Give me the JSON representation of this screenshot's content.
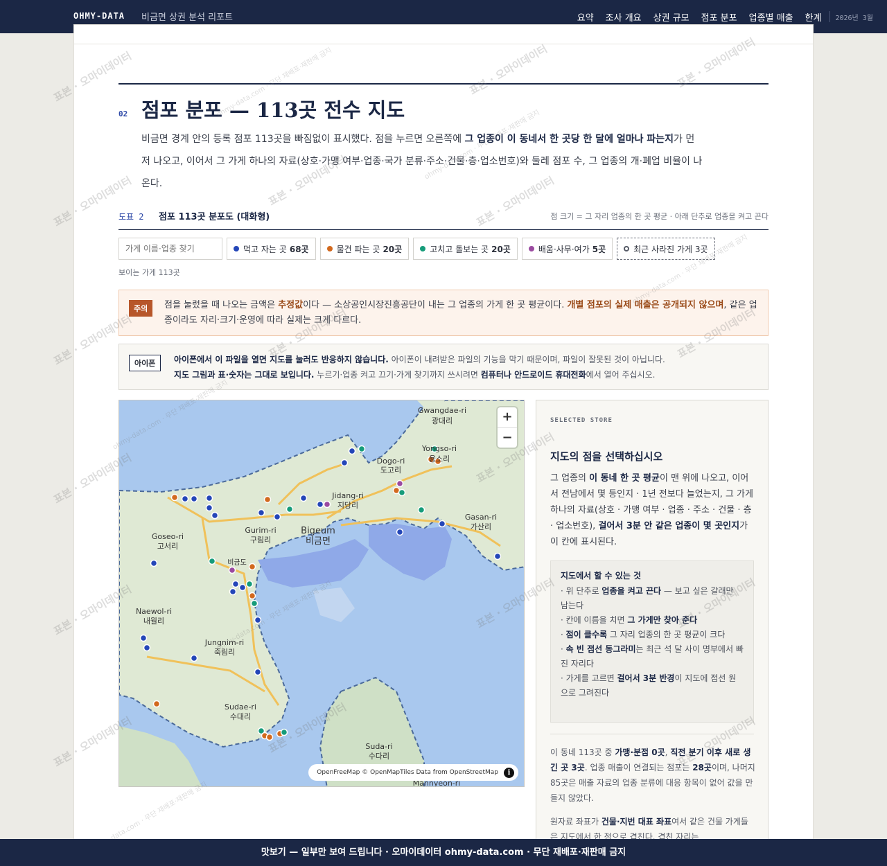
{
  "header": {
    "brand": "OHMY-DATA",
    "report_title": "비금면 상권 분석 리포트",
    "nav": [
      "요약",
      "조사 개요",
      "상권 규모",
      "점포 분포",
      "업종별 매출",
      "한계"
    ],
    "date": "2026년 3월"
  },
  "section": {
    "number": "02",
    "title": "점포 분포 — 113곳 전수 지도",
    "desc_1": "비금면 경계 안의 등록 점포 113곳을 빠짐없이 표시했다. 점을 누르면 오른쪽에 ",
    "desc_bold": "그 업종이 이 동네서 한 곳당 한 달에 얼마나 파는지",
    "desc_2": "가 먼저 나오고, 이어서 그 가게 하나의 자료(상호·가맹 여부·업종·국가 분류·주소·건물·층·업소번호)와 둘레 점포 수, 그 업종의 개·폐업 비율이 나온다."
  },
  "figure": {
    "label": "도표 2",
    "title": "점포 113곳 분포도 (대화형)",
    "note": "점 크기 = 그 자리 업종의 한 곳 평균 · 아래 단추로 업종을 켜고 끈다"
  },
  "search": {
    "placeholder": "가게 이름·업종 찾기"
  },
  "filters": [
    {
      "label": "먹고 자는 곳",
      "count": "68곳",
      "color": "#2446b8"
    },
    {
      "label": "물건 파는 곳",
      "count": "20곳",
      "color": "#d2691e"
    },
    {
      "label": "고치고 돌보는 곳",
      "count": "20곳",
      "color": "#169c7a"
    },
    {
      "label": "배움·사무·여가",
      "count": "5곳",
      "color": "#9a4aa0"
    }
  ],
  "closed_filter": {
    "label": "최근 사라진 가게",
    "count": "3곳"
  },
  "visible_count": "보이는 가게 113곳",
  "warning": {
    "tag": "주의",
    "t1": "점을 눌렀을 때 나오는 금액은 ",
    "b1": "추정값",
    "t2": "이다 — 소상공인시장진흥공단이 내는 그 업종의 가게 한 곳 평균이다. ",
    "b2": "개별 점포의 실제 매출은 공개되지 않으며",
    "t3": ", 같은 업종이라도 자리·크기·운영에 따라 실제는 크게 다르다."
  },
  "iphone": {
    "tag": "아이폰",
    "b1": "아이폰에서 이 파일을 열면 지도를 눌러도 반응하지 않습니다.",
    "t1": " 아이폰이 내려받은 파일의 기능을 막기 때문이며, 파일이 잘못된 것이 아닙니다.",
    "b2": "지도 그림과 표·숫자는 그대로 보입니다.",
    "t2": " 누르기·업종 켜고 끄기·가게 찾기까지 쓰시려면 ",
    "b3": "컴퓨터나 안드로이드 휴대전화",
    "t3": "에서 열어 주십시오."
  },
  "map": {
    "zoom_in": "+",
    "zoom_out": "−",
    "attribution": "OpenFreeMap © OpenMapTiles Data from OpenStreetMap",
    "info": "i",
    "places": [
      {
        "en": "Gwangdae-ri",
        "ko": "광대리"
      },
      {
        "en": "Yongso-ri",
        "ko": "용소리"
      },
      {
        "en": "Dogo-ri",
        "ko": "도고리"
      },
      {
        "en": "Jidang-ri",
        "ko": "지당리"
      },
      {
        "en": "Gasan-ri",
        "ko": "가산리"
      },
      {
        "en": "Gurim-ri",
        "ko": "구림리"
      },
      {
        "en": "Bigeum",
        "ko": "비금면"
      },
      {
        "en": "Goseo-ri",
        "ko": "고서리"
      },
      {
        "en": "Naewol-ri",
        "ko": "내월리"
      },
      {
        "en": "Jungnim-ri",
        "ko": "죽림리"
      },
      {
        "en": "Sudae-ri",
        "ko": "수대리"
      },
      {
        "en": "Suda-ri",
        "ko": "수다리"
      },
      {
        "en": "Mannyeon-ri",
        "ko": ""
      }
    ],
    "poi": "비금도"
  },
  "panel": {
    "kicker": "SELECTED STORE",
    "title": "지도의 점을 선택하십시오",
    "d1": "그 업종의 ",
    "d1b": "이 동네 한 곳 평균",
    "d2": "이 맨 위에 나오고, 이어서 전남에서 몇 등인지 · 1년 전보다 늘었는지, 그 가게 하나의 자료(상호 · 가맹 여부 · 업종 · 주소 · 건물 · 층 · 업소번호), ",
    "d2b": "걸어서 3분 안 같은 업종이 몇 곳인지",
    "d3": "가 이 칸에 표시된다.",
    "howto_title": "지도에서 할 수 있는 것",
    "howto_1a": "· 위 단추로 ",
    "howto_1b": "업종을 켜고 끈다",
    "howto_1c": " — 보고 싶은 갈래만 남는다",
    "howto_2a": "· 칸에 이름을 치면 ",
    "howto_2b": "그 가게만 찾아 준다",
    "howto_3a": "· ",
    "howto_3b": "점이 클수록",
    "howto_3c": " 그 자리 업종의 한 곳 평균이 크다",
    "howto_4a": "· ",
    "howto_4b": "속 빈 점선 동그라미",
    "howto_4c": "는 최근 석 달 사이 명부에서 빠진 자리다",
    "howto_5a": "· 가게를 고르면 ",
    "howto_5b": "걸어서 3분 반경",
    "howto_5c": "이 지도에 점선 원으로 그려진다",
    "stat_1": "이 동네 113곳 중 ",
    "stat_b1": "가맹·분점 0곳",
    "stat_2": ", ",
    "stat_b2": "직전 분기 이후 새로 생긴 곳 3곳",
    "stat_3": ". 업종 매출이 연결되는 점포는 ",
    "stat_b3": "28곳",
    "stat_4": "이며, 나머지 85곳은 매출 자료의 업종 분류에 대응 항목이 없어 값을 만들지 않았다.",
    "raw_1": "원자료 좌표가 ",
    "raw_b1": "건물·지번 대표 좌표",
    "raw_2": "여서 같은 건물 가게들은 지도에서 한 점으로 겹친다. 겹친 자리는"
  },
  "watermark": {
    "main": "표본 · 오마이데이터",
    "sub": "ohmy-data.com · 무단 재배포·재판매 금지"
  },
  "footer": "맛보기 — 일부만 보여 드립니다 · 오마이데이터 ohmy-data.com · 무단 재배포·재판매 금지"
}
